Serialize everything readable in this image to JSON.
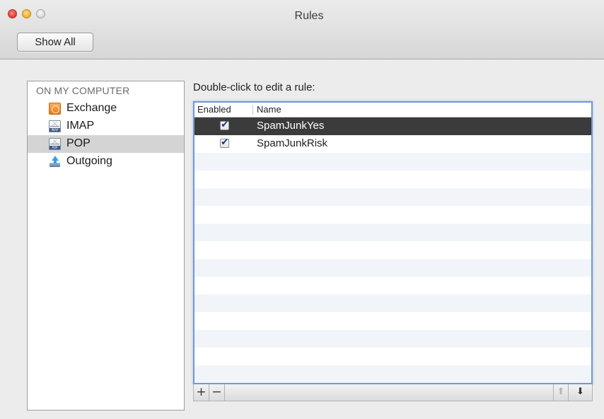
{
  "window": {
    "title": "Rules",
    "show_all_label": "Show All"
  },
  "sidebar": {
    "heading": "ON MY COMPUTER",
    "items": [
      {
        "label": "Exchange",
        "icon": "exchange-icon",
        "selected": false
      },
      {
        "label": "IMAP",
        "icon": "imap-mail-icon",
        "icon_text": "IMAP",
        "selected": false
      },
      {
        "label": "POP",
        "icon": "pop-mail-icon",
        "icon_text": "POP",
        "selected": true
      },
      {
        "label": "Outgoing",
        "icon": "outgoing-icon",
        "selected": false
      }
    ]
  },
  "rules": {
    "instruction": "Double-click to edit a rule:",
    "columns": [
      "Enabled",
      "Name"
    ],
    "rows": [
      {
        "enabled": true,
        "name": "SpamJunkYes",
        "selected": true
      },
      {
        "enabled": true,
        "name": "SpamJunkRisk",
        "selected": false
      }
    ]
  },
  "toolbar": {
    "add_label": "+",
    "remove_label": "−",
    "move_up_icon": "up-arrow-icon",
    "move_down_icon": "down-arrow-icon",
    "move_up_glyph": "⬆",
    "move_down_glyph": "⬇"
  },
  "colors": {
    "selection_dark": "#3b3b3b",
    "sidebar_selected": "#d4d4d4",
    "focus_ring": "#6f9ad3",
    "row_stripe": "#f1f5fa"
  }
}
